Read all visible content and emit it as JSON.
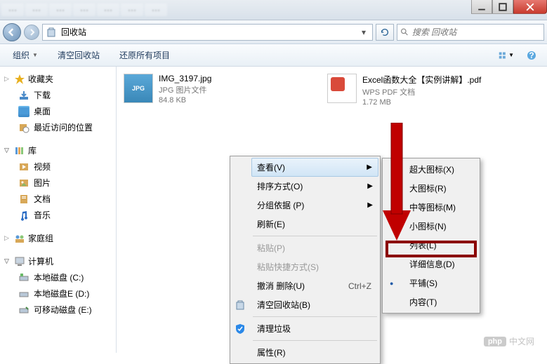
{
  "window": {
    "min_tooltip": "最小化",
    "max_tooltip": "最大化",
    "close_tooltip": "关闭"
  },
  "address": {
    "location": "回收站",
    "search_placeholder": "搜索 回收站"
  },
  "toolbar": {
    "organize": "组织",
    "empty": "清空回收站",
    "restore_all": "还原所有项目"
  },
  "sidebar": {
    "favorites": {
      "label": "收藏夹",
      "items": [
        "下载",
        "桌面",
        "最近访问的位置"
      ]
    },
    "libraries": {
      "label": "库",
      "items": [
        "视频",
        "图片",
        "文档",
        "音乐"
      ]
    },
    "homegroup": {
      "label": "家庭组"
    },
    "computer": {
      "label": "计算机",
      "items": [
        "本地磁盘 (C:)",
        "本地磁盘E (D:)",
        "可移动磁盘 (E:)"
      ]
    }
  },
  "files": [
    {
      "name": "IMG_3197.jpg",
      "type": "JPG 图片文件",
      "size": "84.8 KB",
      "thumb": "JPG"
    },
    {
      "name": "Excel函数大全【实例讲解】.pdf",
      "type": "WPS PDF 文档",
      "size": "1.72 MB",
      "thumb": "PDF"
    }
  ],
  "context_menu": {
    "items": [
      {
        "label": "查看(V)",
        "submenu": true,
        "hovered": true
      },
      {
        "label": "排序方式(O)",
        "submenu": true
      },
      {
        "label": "分组依据 (P)",
        "submenu": true
      },
      {
        "label": "刷新(E)"
      },
      {
        "sep": true
      },
      {
        "label": "粘贴(P)",
        "disabled": true
      },
      {
        "label": "粘贴快捷方式(S)",
        "disabled": true
      },
      {
        "label": "撤消 删除(U)",
        "hotkey": "Ctrl+Z"
      },
      {
        "label": "清空回收站(B)",
        "icon": "recycle"
      },
      {
        "sep": true
      },
      {
        "label": "清理垃圾",
        "icon": "shield"
      },
      {
        "sep": true
      },
      {
        "label": "属性(R)"
      }
    ]
  },
  "submenu": {
    "items": [
      {
        "label": "超大图标(X)"
      },
      {
        "label": "大图标(R)"
      },
      {
        "label": "中等图标(M)"
      },
      {
        "label": "小图标(N)"
      },
      {
        "label": "列表(L)"
      },
      {
        "label": "详细信息(D)",
        "highlighted": true
      },
      {
        "label": "平铺(S)",
        "radio": true
      },
      {
        "label": "内容(T)"
      }
    ]
  },
  "watermark": {
    "badge": "php",
    "text": "中文网"
  }
}
